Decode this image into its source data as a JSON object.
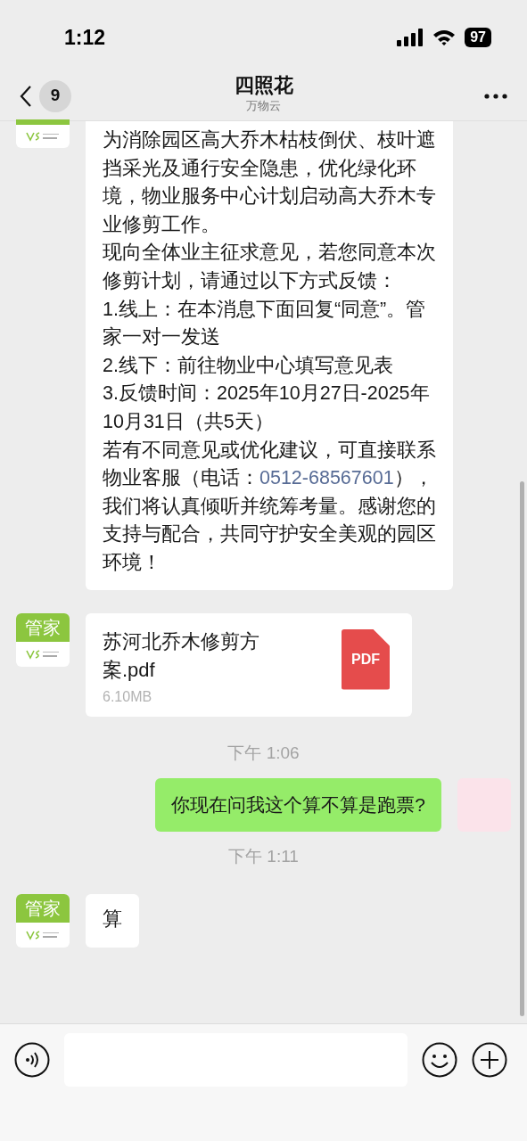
{
  "status_bar": {
    "time": "1:12",
    "battery": "97"
  },
  "nav": {
    "back_badge": "9",
    "title": "四照花",
    "subtitle": "万物云"
  },
  "messages": [
    {
      "kind": "incoming",
      "paragraphs": [
        {
          "text": "为消除园区高大乔木枯枝倒伏、枝叶遮挡采光及通行安全隐患，优化绿化环境，物业服务中心计划启动高大乔木专业修剪工作。"
        },
        {
          "text": "现向全体业主征求意见，若您同意本次修剪计划，请通过以下方式反馈："
        },
        {
          "text": "1.线上：在本消息下面回复“同意”。管家一对一发送"
        },
        {
          "text": "2.线下：前往物业中心填写意见表"
        },
        {
          "text": "3.反馈时间：2025年10月27日-2025年10月31日（共5天）"
        },
        {
          "text": "若有不同意见或优化建议，可直接联系物业客服（电话：",
          "link": "0512-68567601",
          "after": "），我们将认真倾听并统筹考量。感谢您的支持与配合，共同守护安全美观的园区环境！"
        }
      ]
    },
    {
      "kind": "file",
      "avatar_label": "管家",
      "file_name": "苏河北乔木修剪方案.pdf",
      "file_size": "6.10MB",
      "file_type": "PDF"
    },
    {
      "kind": "time",
      "text": "下午 1:06"
    },
    {
      "kind": "outgoing",
      "paragraphs": [
        {
          "text": "你现在问我这个算不算是跑票?"
        }
      ]
    },
    {
      "kind": "time",
      "text": "下午 1:11"
    },
    {
      "kind": "incoming",
      "avatar_label": "管家",
      "paragraphs": [
        {
          "text": "算"
        }
      ]
    }
  ]
}
